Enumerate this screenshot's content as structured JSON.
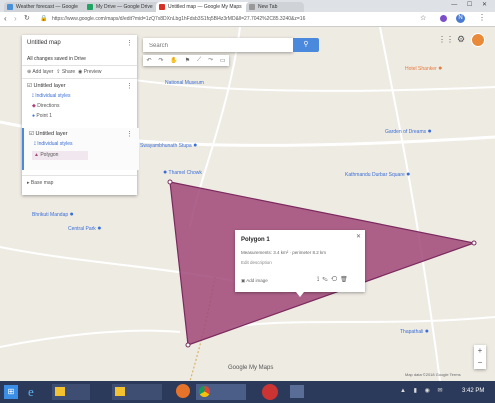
{
  "browser": {
    "tabs": [
      {
        "label": "Weather forecast — Google"
      },
      {
        "label": "My Drive — Google Drive"
      },
      {
        "label": "Untitled map — Google My Maps"
      },
      {
        "label": "New Tab"
      }
    ],
    "address": "https://www.google.com/maps/d/edit?mid=1zQ7x8DXnLbg1hFdsb3S1fq5Bl4z3rMD&ll=27.7042%2C85.3240&z=16",
    "profile_initial": "N"
  },
  "map_header": {
    "title": "Untitled map",
    "subtitle": "All changes saved in Drive",
    "actions": [
      "Add layer",
      "Share",
      "Preview"
    ],
    "search_placeholder": "Search"
  },
  "layers": [
    {
      "name": "Untitled layer",
      "style_link": "Individual styles",
      "item1": "Directions",
      "item2": "Point 1"
    },
    {
      "name": "Untitled layer",
      "style_link": "Individual styles",
      "item1": "Polygon"
    }
  ],
  "base_map": {
    "label": "Base map"
  },
  "toolbar": {
    "icons": [
      "undo-icon",
      "redo-icon",
      "hand-icon",
      "marker-icon",
      "line-icon",
      "route-icon",
      "ruler-icon"
    ]
  },
  "popup": {
    "title": "Polygon 1",
    "lines": [
      "Measurements: 3.4 km² · perimeter 8.2 km",
      "Edit description"
    ],
    "footer": "Add image"
  },
  "places": [
    {
      "label": "Hotel Shanker",
      "color": "#e87a3c"
    },
    {
      "label": "National Museum"
    },
    {
      "label": "Swayambhunath Stupa"
    },
    {
      "label": "Garden of Dreams"
    },
    {
      "label": "Thamel Chowk"
    },
    {
      "label": "Kathmandu Durbar Square"
    },
    {
      "label": "Bhrikuti Mandap"
    },
    {
      "label": "Central Park"
    },
    {
      "label": "Thapathali"
    }
  ],
  "map_footer": {
    "logo": "Google My Maps",
    "attribution": "Map data ©2018 Google  Terms",
    "zoom_in": "+",
    "zoom_out": "−"
  },
  "taskbar": {
    "apps": [
      "Start",
      "Internet Explorer",
      "File Explorer",
      "Documents",
      "Google Chrome",
      "Opera",
      "Media Player"
    ],
    "clock": "3:42 PM"
  },
  "polygon": {
    "fill": "#a04878",
    "stroke": "#7b2a5e"
  }
}
